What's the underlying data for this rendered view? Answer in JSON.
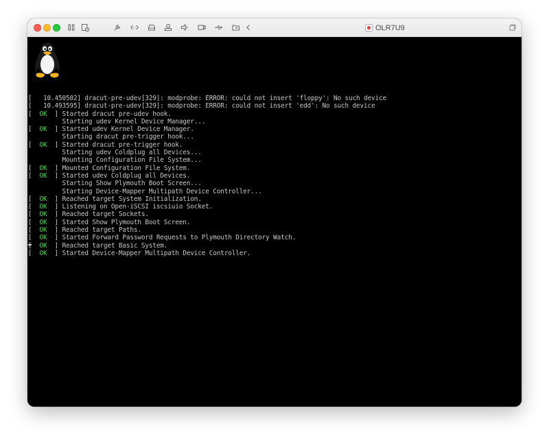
{
  "window": {
    "title": "OLR7U9"
  },
  "toolbar_icons": [
    "pause-icon",
    "snapshot-icon",
    "settings-wrench-icon",
    "code-arrows-icon",
    "disk-icon",
    "printer-icon",
    "speaker-icon",
    "camera-icon",
    "usb-icon",
    "folder-share-icon",
    "back-chevron-icon"
  ],
  "console": {
    "lines": [
      {
        "prefix": "[   ",
        "status": "",
        "text": "10.450502] dracut-pre-udev[329]: modprobe: ERROR: could not insert 'floppy': No such device"
      },
      {
        "prefix": "[   ",
        "status": "",
        "text": "10.493595] dracut-pre-udev[329]: modprobe: ERROR: could not insert 'edd': No such device"
      },
      {
        "prefix": "[  ",
        "status": "OK",
        "text": "  ] Started dracut pre-udev hook."
      },
      {
        "prefix": "",
        "status": "",
        "text": "         Starting udev Kernel Device Manager..."
      },
      {
        "prefix": "[  ",
        "status": "OK",
        "text": "  ] Started udev Kernel Device Manager."
      },
      {
        "prefix": "",
        "status": "",
        "text": "         Starting dracut pre-trigger hook..."
      },
      {
        "prefix": "[  ",
        "status": "OK",
        "text": "  ] Started dracut pre-trigger hook."
      },
      {
        "prefix": "",
        "status": "",
        "text": "         Starting udev Coldplug all Devices..."
      },
      {
        "prefix": "",
        "status": "",
        "text": "         Mounting Configuration File System..."
      },
      {
        "prefix": "[  ",
        "status": "OK",
        "text": "  ] Mounted Configuration File System."
      },
      {
        "prefix": "[  ",
        "status": "OK",
        "text": "  ] Started udev Coldplug all Devices."
      },
      {
        "prefix": "",
        "status": "",
        "text": "         Starting Show Plymouth Boot Screen..."
      },
      {
        "prefix": "",
        "status": "",
        "text": "         Starting Device-Mapper Multipath Device Controller..."
      },
      {
        "prefix": "[  ",
        "status": "OK",
        "text": "  ] Reached target System Initialization."
      },
      {
        "prefix": "[  ",
        "status": "OK",
        "text": "  ] Listening on Open-iSCSI iscsiuio Socket."
      },
      {
        "prefix": "[  ",
        "status": "OK",
        "text": "  ] Reached target Sockets."
      },
      {
        "prefix": "[  ",
        "status": "OK",
        "text": "  ] Started Show Plymouth Boot Screen."
      },
      {
        "prefix": "[  ",
        "status": "OK",
        "text": "  ] Reached target Paths."
      },
      {
        "prefix": "[  ",
        "status": "OK",
        "text": "  ] Started Forward Password Requests to Plymouth Directory Watch."
      },
      {
        "prefix": "[  ",
        "status": "OK",
        "text": "  ] Reached target Basic System."
      },
      {
        "prefix": "[  ",
        "status": "OK",
        "text": "  ] Started Device-Mapper Multipath Device Controller."
      }
    ]
  },
  "colors": {
    "ok_status": "#4fdc4f",
    "console_text": "#c8c8c8",
    "console_bg": "#000000"
  }
}
